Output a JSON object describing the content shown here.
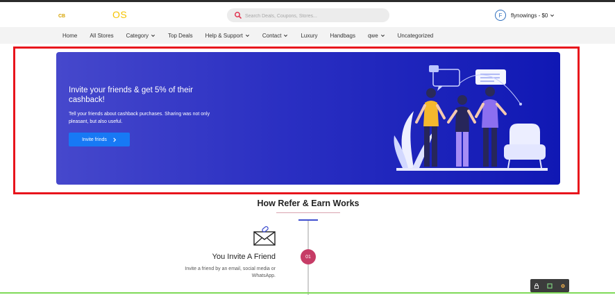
{
  "header": {
    "logo_small": "CB",
    "logo_main": "OS",
    "search_placeholder": "Search Deals, Coupons, Stores...",
    "user_initial": "F",
    "user_label": "flynowings - $0"
  },
  "nav": {
    "items": [
      {
        "label": "Home",
        "dropdown": false
      },
      {
        "label": "All Stores",
        "dropdown": false
      },
      {
        "label": "Category",
        "dropdown": true
      },
      {
        "label": "Top Deals",
        "dropdown": false
      },
      {
        "label": "Help & Support",
        "dropdown": true
      },
      {
        "label": "Contact",
        "dropdown": true
      },
      {
        "label": "Luxury",
        "dropdown": false
      },
      {
        "label": "Handbags",
        "dropdown": false
      },
      {
        "label": "qwe",
        "dropdown": true
      },
      {
        "label": "Uncategorized",
        "dropdown": false
      }
    ]
  },
  "banner": {
    "title": "Invite your friends & get 5% of their cashback!",
    "text": "Tell your friends about cashback purchases. Sharing was not only pleasant, but also useful.",
    "button_label": "Invite frinds"
  },
  "how_it_works": {
    "title": "How Refer & Earn Works",
    "steps": [
      {
        "number": "01",
        "title": "You Invite A Friend",
        "description": "Invite a friend by an email, social media or WhatsApp."
      }
    ]
  },
  "colors": {
    "banner_start": "#4648cc",
    "banner_end": "#1018b4",
    "button": "#1779f5",
    "step_badge": "#c63c66",
    "highlight": "#e8141c",
    "logo": "#f5c400"
  }
}
